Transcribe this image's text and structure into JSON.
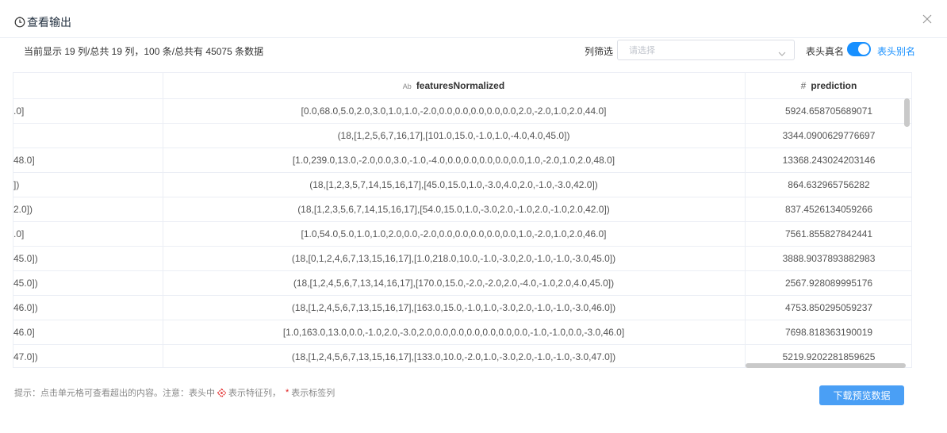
{
  "dialog": {
    "title": "查看输出"
  },
  "info": {
    "summary": "当前显示 19 列/总共 19 列，100 条/总共有 45075 条数据"
  },
  "filter": {
    "label": "列筛选",
    "placeholder": "请选择"
  },
  "header_toggle": {
    "left_label": "表头真名",
    "right_label": "表头别名",
    "on": true
  },
  "table": {
    "columns": [
      {
        "name": "",
        "type_icon": ""
      },
      {
        "name": "featuresNormalized",
        "type_icon": "Ab"
      },
      {
        "name": "prediction",
        "type_icon": "#"
      }
    ],
    "rows": [
      [
        ".0]",
        "[0.0,68.0,5.0,2.0,3.0,1.0,1.0,-2.0,0.0,0.0,0.0,0.0,0.0,2.0,-2.0,1.0,2.0,44.0]",
        "5924.658705689071"
      ],
      [
        "",
        "(18,[1,2,5,6,7,16,17],[101.0,15.0,-1.0,1.0,-4.0,4.0,45.0])",
        "3344.0900629776697"
      ],
      [
        "48.0]",
        "[1.0,239.0,13.0,-2.0,0.0,3.0,-1.0,-4.0,0.0,0.0,0.0,0.0,0.0,1.0,-2.0,1.0,2.0,48.0]",
        "13368.243024203146"
      ],
      [
        "])",
        "(18,[1,2,3,5,7,14,15,16,17],[45.0,15.0,1.0,-3.0,4.0,2.0,-1.0,-3.0,42.0])",
        "864.632965756282"
      ],
      [
        "2.0])",
        "(18,[1,2,3,5,6,7,14,15,16,17],[54.0,15.0,1.0,-3.0,2.0,-1.0,2.0,-1.0,2.0,42.0])",
        "837.4526134059266"
      ],
      [
        ".0]",
        "[1.0,54.0,5.0,1.0,1.0,2.0,0.0,-2.0,0.0,0.0,0.0,0.0,0.0,1.0,-2.0,1.0,2.0,46.0]",
        "7561.855827842441"
      ],
      [
        "45.0])",
        "(18,[0,1,2,4,6,7,13,15,16,17],[1.0,218.0,10.0,-1.0,-3.0,2.0,-1.0,-1.0,-3.0,45.0])",
        "3888.9037893882983"
      ],
      [
        "45.0])",
        "(18,[1,2,4,5,6,7,13,14,16,17],[170.0,15.0,-2.0,-2.0,2.0,-4.0,-1.0,2.0,4.0,45.0])",
        "2567.928089995176"
      ],
      [
        "46.0])",
        "(18,[1,2,4,5,6,7,13,15,16,17],[163.0,15.0,-1.0,1.0,-3.0,2.0,-1.0,-1.0,-3.0,46.0])",
        "4753.850295059237"
      ],
      [
        "46.0]",
        "[1.0,163.0,13.0,0.0,-1.0,2.0,-3.0,2.0,0.0,0.0,0.0,0.0,0.0,0.0,-1.0,-1.0,0.0,-3.0,46.0]",
        "7698.818363190019"
      ],
      [
        "47.0])",
        "(18,[1,2,4,5,6,7,13,15,16,17],[133.0,10.0,-2.0,1.0,-3.0,2.0,-1.0,-1.0,-3.0,47.0])",
        "5219.9202281859625"
      ]
    ]
  },
  "hint": {
    "prefix": "提示：点击单元格可查看超出的内容。注意：表头中",
    "feature_text": "表示特征列，",
    "star": "*",
    "label_text": "表示标签列"
  },
  "download": {
    "label": "下载预览数据"
  },
  "colors": {
    "accent": "#1890ff",
    "button": "#4a9ff5",
    "star": "#e02020"
  },
  "icons": {
    "title": "clock-icon",
    "close": "close-icon",
    "select": "chevron-down-icon",
    "feature": "feature-diamond-icon"
  }
}
